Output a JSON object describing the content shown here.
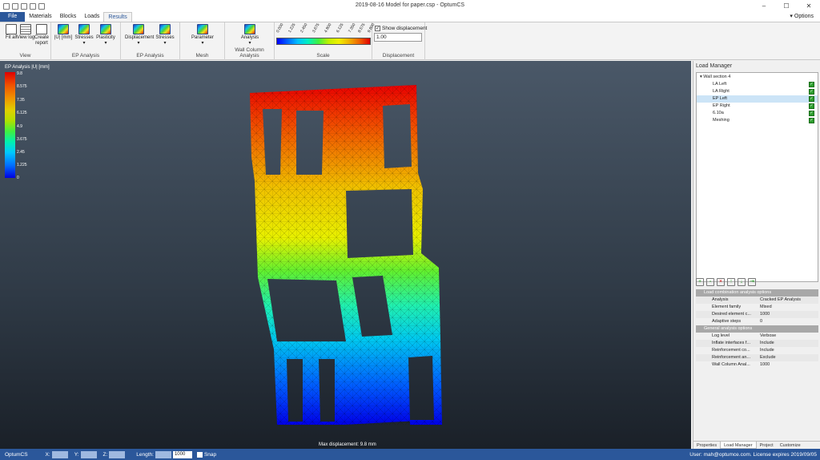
{
  "window": {
    "title": "2019-08-16 Model for paper.csp - OptumCS",
    "options_label": "Options"
  },
  "tabs": [
    "File",
    "Materials",
    "Blocks",
    "Loads",
    "Results"
  ],
  "ribbon": {
    "view": {
      "label": "View",
      "fit_all": "Fit all",
      "view_log": "View log",
      "create_report": "Create report"
    },
    "ep_analysis_1": {
      "label": "EP Analysis",
      "u": "|U| [mm]",
      "stresses": "Stresses",
      "plasticity": "Plasticity"
    },
    "ep_analysis_2": {
      "label": "EP Analysis",
      "displacement": "Displacement",
      "stresses": "Stresses"
    },
    "mesh": {
      "label": "Mesh",
      "parameter": "Parameter"
    },
    "wall_column": {
      "label": "Wall Column Analysis",
      "analysis": "Analysis"
    },
    "scale": {
      "label": "Scale",
      "ticks": [
        "0.000",
        "1.225",
        "2.450",
        "3.675",
        "4.900",
        "6.125",
        "7.350",
        "8.575",
        "9.800"
      ]
    },
    "displacement": {
      "label": "Displacement",
      "show": "Show displacement",
      "value": "1.00"
    }
  },
  "viewport": {
    "title": "EP Analysis |U| [mm]",
    "legend": [
      "9.8",
      "8.575",
      "7.35",
      "6.125",
      "4.9",
      "3.675",
      "2.45",
      "1.225",
      "0"
    ],
    "max_displacement": "Max displacement: 9.8 mm"
  },
  "load_manager": {
    "title": "Load Manager",
    "root": "Wall section 4",
    "items": [
      {
        "label": "LA Left",
        "checked": true
      },
      {
        "label": "LA Right",
        "checked": true
      },
      {
        "label": "EP Left",
        "checked": true,
        "selected": true
      },
      {
        "label": "EP Right",
        "checked": true
      },
      {
        "label": "6.10a",
        "checked": true
      },
      {
        "label": "Meshing",
        "checked": true
      }
    ]
  },
  "properties": {
    "section1": "Load combination analysis options",
    "rows1": [
      {
        "k": "Analysis",
        "v": "Cracked EP Analysis"
      },
      {
        "k": "Element family",
        "v": "Mixed"
      },
      {
        "k": "Desired element c...",
        "v": "1000"
      },
      {
        "k": "Adaptive steps",
        "v": "0"
      }
    ],
    "section2": "General analysis options",
    "rows2": [
      {
        "k": "Log level",
        "v": "Verbose"
      },
      {
        "k": "Inflate interfaces f...",
        "v": "Include"
      },
      {
        "k": "Reinforcement co...",
        "v": "Include"
      },
      {
        "k": "Reinforcement an...",
        "v": "Exclude"
      },
      {
        "k": "Wall Column Anal...",
        "v": "1000"
      }
    ]
  },
  "panel_tabs": [
    "Properties",
    "Load Manager",
    "Project",
    "Customize"
  ],
  "status": {
    "app": "OptumCS",
    "x": "X:",
    "y": "Y:",
    "z": "Z:",
    "length_label": "Length:",
    "length_value": "1000",
    "snap": "Snap",
    "user": "User: mah@optumce.com. License expires 2019/09/05"
  }
}
